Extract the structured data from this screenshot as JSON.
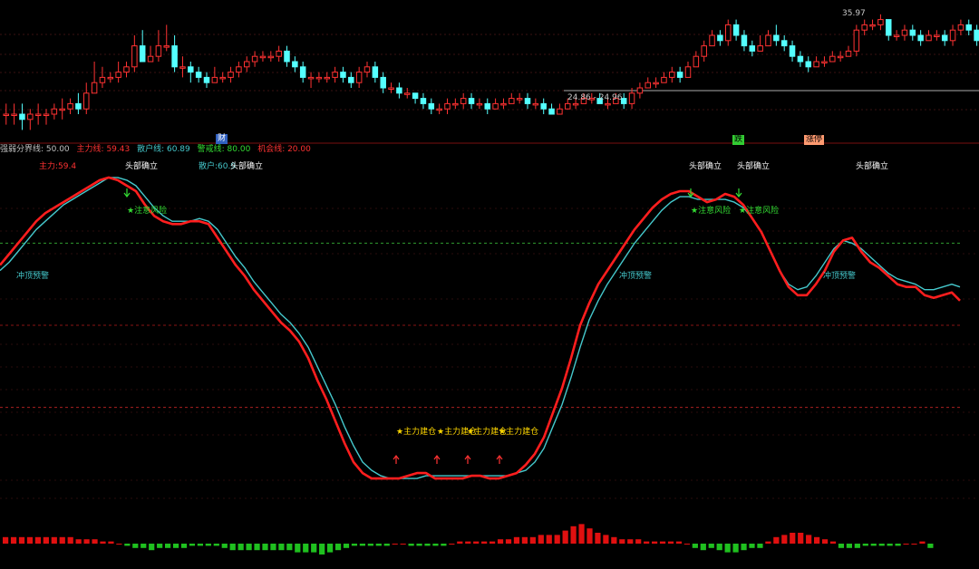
{
  "price": {
    "high_label": "35.97",
    "low_label": "24.86 - 24.96",
    "candles": [
      [
        20,
        20,
        22,
        18
      ],
      [
        20,
        20,
        22,
        18
      ],
      [
        20,
        19,
        22,
        17
      ],
      [
        19,
        20,
        21,
        17
      ],
      [
        20,
        20,
        22,
        18
      ],
      [
        20,
        20,
        21,
        18
      ],
      [
        20,
        21,
        22,
        19
      ],
      [
        21,
        21,
        23,
        19
      ],
      [
        21,
        22,
        23,
        20
      ],
      [
        22,
        21,
        24,
        20
      ],
      [
        21,
        24,
        26,
        20
      ],
      [
        24,
        26,
        30,
        24
      ],
      [
        26,
        27,
        29,
        25
      ],
      [
        27,
        27,
        28,
        26
      ],
      [
        27,
        28,
        30,
        26
      ],
      [
        28,
        29,
        30,
        27
      ],
      [
        29,
        33,
        35,
        28
      ],
      [
        33,
        30,
        36,
        30
      ],
      [
        30,
        31,
        33,
        30
      ],
      [
        31,
        33,
        36,
        30
      ],
      [
        33,
        33,
        37,
        32
      ],
      [
        33,
        29,
        35,
        28
      ],
      [
        29,
        29,
        31,
        27
      ],
      [
        29,
        28,
        30,
        26
      ],
      [
        28,
        27,
        29,
        26
      ],
      [
        27,
        26,
        28,
        25
      ],
      [
        26,
        27,
        29,
        26
      ],
      [
        27,
        27,
        28,
        26
      ],
      [
        27,
        28,
        29,
        26
      ],
      [
        28,
        29,
        30,
        27
      ],
      [
        29,
        30,
        31,
        28
      ],
      [
        30,
        31,
        32,
        29
      ],
      [
        31,
        31,
        32,
        30
      ],
      [
        31,
        31,
        32,
        30
      ],
      [
        31,
        32,
        33,
        30
      ],
      [
        32,
        30,
        33,
        29
      ],
      [
        30,
        29,
        31,
        28
      ],
      [
        29,
        27,
        30,
        26
      ],
      [
        27,
        27,
        28,
        25
      ],
      [
        27,
        27,
        28,
        26
      ],
      [
        27,
        27,
        28,
        26
      ],
      [
        27,
        28,
        29,
        26
      ],
      [
        28,
        27,
        29,
        26
      ],
      [
        27,
        26,
        28,
        25
      ],
      [
        26,
        28,
        29,
        25
      ],
      [
        28,
        29,
        30,
        27
      ],
      [
        29,
        27,
        30,
        26
      ],
      [
        27,
        25,
        28,
        24
      ],
      [
        25,
        25,
        26,
        24
      ],
      [
        25,
        24,
        26,
        23
      ],
      [
        24,
        24,
        25,
        23
      ],
      [
        24,
        23,
        24,
        22
      ],
      [
        23,
        22,
        24,
        21
      ],
      [
        22,
        21,
        23,
        20
      ],
      [
        21,
        21,
        22,
        20
      ],
      [
        21,
        22,
        23,
        20
      ],
      [
        22,
        22,
        23,
        21
      ],
      [
        22,
        23,
        24,
        21
      ],
      [
        23,
        22,
        24,
        21
      ],
      [
        22,
        22,
        23,
        21
      ],
      [
        22,
        21,
        23,
        20
      ],
      [
        21,
        22,
        23,
        21
      ],
      [
        22,
        22,
        23,
        21
      ],
      [
        22,
        23,
        24,
        22
      ],
      [
        23,
        23,
        24,
        22
      ],
      [
        23,
        22,
        24,
        21
      ],
      [
        22,
        22,
        23,
        21
      ],
      [
        22,
        21,
        23,
        20
      ],
      [
        21,
        20,
        22,
        20
      ],
      [
        20,
        21,
        22,
        20
      ],
      [
        21,
        22,
        23,
        21
      ],
      [
        22,
        22,
        23,
        21
      ],
      [
        22,
        23,
        24,
        22
      ],
      [
        23,
        23,
        24,
        22
      ],
      [
        23,
        22,
        24,
        22
      ],
      [
        22,
        22,
        23,
        21
      ],
      [
        22,
        23,
        24,
        22
      ],
      [
        23,
        22,
        24,
        21
      ],
      [
        22,
        24,
        25,
        21
      ],
      [
        24,
        25,
        26,
        23
      ],
      [
        25,
        26,
        27,
        25
      ],
      [
        26,
        26,
        27,
        25
      ],
      [
        26,
        27,
        28,
        26
      ],
      [
        27,
        28,
        29,
        26
      ],
      [
        28,
        27,
        29,
        26
      ],
      [
        27,
        29,
        30,
        27
      ],
      [
        29,
        31,
        32,
        29
      ],
      [
        31,
        33,
        34,
        30
      ],
      [
        33,
        35,
        36,
        33
      ],
      [
        35,
        34,
        36,
        33
      ],
      [
        34,
        37,
        38,
        33
      ],
      [
        37,
        35,
        38,
        34
      ],
      [
        35,
        33,
        36,
        32
      ],
      [
        33,
        32,
        34,
        31
      ],
      [
        32,
        33,
        35,
        32
      ],
      [
        33,
        35,
        36,
        33
      ],
      [
        35,
        34,
        37,
        33
      ],
      [
        34,
        33,
        35,
        32
      ],
      [
        33,
        31,
        34,
        30
      ],
      [
        31,
        30,
        32,
        29
      ],
      [
        30,
        29,
        31,
        28
      ],
      [
        29,
        30,
        31,
        29
      ],
      [
        30,
        30,
        31,
        29
      ],
      [
        30,
        31,
        32,
        30
      ],
      [
        31,
        31,
        32,
        30
      ],
      [
        31,
        32,
        33,
        31
      ],
      [
        32,
        36,
        37,
        31
      ],
      [
        36,
        37,
        38,
        35
      ],
      [
        37,
        37,
        38,
        36
      ],
      [
        37,
        38,
        39,
        36
      ],
      [
        38,
        35,
        38,
        34
      ],
      [
        35,
        35,
        36,
        34
      ],
      [
        35,
        36,
        37,
        34
      ],
      [
        36,
        35,
        37,
        34
      ],
      [
        35,
        34,
        36,
        33
      ],
      [
        34,
        35,
        36,
        34
      ],
      [
        35,
        35,
        36,
        34
      ],
      [
        35,
        34,
        36,
        33
      ],
      [
        34,
        36,
        37,
        33
      ],
      [
        36,
        37,
        38,
        35
      ],
      [
        37,
        36,
        38,
        35
      ],
      [
        36,
        34,
        37,
        33
      ]
    ]
  },
  "divider": {
    "cai": "财",
    "die": "跌",
    "zhang": "涨停"
  },
  "indicator_header": {
    "strong_weak": "强弱分界线: 50.00",
    "main_line": "主力线: 59.43",
    "retail_line": "散户线: 60.89",
    "warning_line": "警戒线: 80.00",
    "opportunity_line": "机会线: 20.00"
  },
  "indicator_labels": {
    "main_value": "主力:59.4",
    "retail_value": "散户:60.9",
    "top_confirm": "头部确立",
    "caution": "★注意风险",
    "rush_top": "冲顶预警",
    "build": "★主力建仓"
  },
  "colors": {
    "up": "#ff3232",
    "down": "#54ffff",
    "main_line": "#ff1e1e",
    "retail_line": "#45c8cc",
    "warn_green": "#33dd33",
    "build_yellow": "#ffd700"
  },
  "chart_data": {
    "type": "line",
    "x": [
      0,
      10,
      20,
      30,
      40,
      50,
      60,
      70,
      80,
      90,
      100,
      110,
      120,
      130,
      140,
      150,
      160,
      170,
      180,
      190,
      200,
      210,
      220,
      230,
      240,
      250,
      260,
      270,
      280,
      290,
      300,
      310,
      320,
      330,
      340,
      350,
      360,
      370,
      380,
      390,
      400,
      410,
      420,
      430,
      440,
      450,
      460,
      470,
      480,
      490,
      500,
      510,
      520,
      530,
      540,
      550,
      560,
      570,
      580,
      590,
      600,
      610,
      620,
      630,
      640,
      650,
      660,
      670,
      680,
      690,
      700,
      710,
      720,
      730,
      740,
      750,
      760,
      770,
      780,
      790,
      800,
      810,
      820,
      830,
      840,
      850,
      860,
      870,
      880,
      890,
      900,
      910,
      920,
      930,
      940,
      950,
      960,
      970,
      980,
      990,
      1000,
      1010,
      1020,
      1030,
      1040,
      1050,
      1059
    ],
    "series": [
      {
        "name": "主力",
        "values": [
          72,
          76,
          80,
          84,
          88,
          91,
          93,
          95,
          97,
          99,
          101,
          103,
          104,
          103,
          101,
          99,
          94,
          90,
          88,
          87,
          87,
          88,
          88,
          87,
          82,
          77,
          72,
          68,
          63,
          59,
          55,
          51,
          48,
          44,
          38,
          30,
          23,
          15,
          7,
          0,
          -4,
          -6,
          -6,
          -6,
          -6,
          -5,
          -4,
          -4,
          -6,
          -6,
          -6,
          -6,
          -5,
          -5,
          -6,
          -6,
          -5,
          -4,
          -1,
          3,
          9,
          18,
          27,
          38,
          50,
          58,
          65,
          70,
          75,
          80,
          85,
          89,
          93,
          96,
          98,
          99,
          99,
          97,
          95,
          96,
          98,
          97,
          94,
          89,
          84,
          77,
          70,
          64,
          61,
          61,
          65,
          70,
          77,
          81,
          82,
          77,
          73,
          71,
          68,
          65,
          64,
          64,
          61,
          60,
          61,
          62,
          59
        ]
      },
      {
        "name": "散户",
        "values": [
          70,
          73,
          77,
          81,
          85,
          88,
          91,
          94,
          96,
          98,
          100,
          102,
          104,
          104,
          103,
          101,
          97,
          93,
          90,
          88,
          88,
          88,
          89,
          88,
          85,
          80,
          75,
          71,
          66,
          62,
          58,
          54,
          51,
          47,
          42,
          35,
          28,
          21,
          13,
          6,
          0,
          -3,
          -5,
          -6,
          -6,
          -6,
          -6,
          -5,
          -5,
          -5,
          -5,
          -5,
          -5,
          -5,
          -5,
          -5,
          -5,
          -4,
          -3,
          0,
          5,
          13,
          21,
          31,
          42,
          52,
          59,
          65,
          70,
          75,
          80,
          84,
          88,
          92,
          95,
          97,
          97,
          96,
          96,
          96,
          96,
          95,
          93,
          89,
          84,
          77,
          70,
          65,
          63,
          64,
          68,
          73,
          78,
          81,
          80,
          78,
          75,
          72,
          69,
          67,
          66,
          65,
          63,
          63,
          64,
          65,
          64
        ]
      }
    ],
    "ylim": [
      -20,
      120
    ],
    "reference_lines": [
      50,
      80,
      20
    ],
    "volume_bars": [
      3,
      3,
      3,
      3,
      3,
      3,
      3,
      3,
      3,
      2,
      2,
      2,
      1,
      1,
      0,
      -1,
      -2,
      -2,
      -3,
      -2,
      -2,
      -2,
      -2,
      -1,
      -1,
      -1,
      -1,
      -2,
      -3,
      -3,
      -3,
      -3,
      -3,
      -3,
      -3,
      -3,
      -4,
      -4,
      -4,
      -5,
      -4,
      -3,
      -2,
      -1,
      -1,
      -1,
      -1,
      -1,
      0,
      0,
      -1,
      -1,
      -1,
      -1,
      -1,
      0,
      1,
      1,
      1,
      1,
      1,
      2,
      2,
      3,
      3,
      3,
      4,
      4,
      4,
      6,
      8,
      9,
      7,
      5,
      4,
      3,
      2,
      2,
      2,
      1,
      1,
      1,
      1,
      1,
      0,
      -2,
      -3,
      -2,
      -3,
      -4,
      -4,
      -3,
      -2,
      -2,
      1,
      3,
      4,
      5,
      5,
      4,
      3,
      2,
      1,
      -2,
      -2,
      -2,
      -1,
      -1,
      -1,
      -1,
      -1,
      0,
      0,
      1,
      -2
    ]
  }
}
